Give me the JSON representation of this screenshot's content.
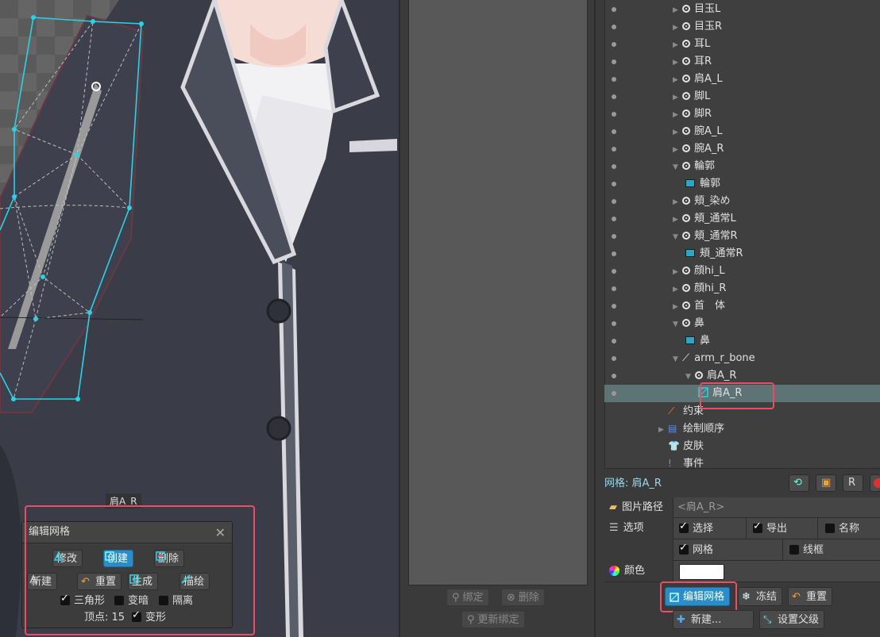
{
  "viewport": {
    "mesh_label": "肩A_R"
  },
  "edit_mesh_dialog": {
    "title": "编辑网格",
    "modes": {
      "modify": "修改",
      "create": "创建",
      "delete": "删除"
    },
    "actions": {
      "new": "新建",
      "reset": "重置",
      "generate": "生成",
      "trace": "描绘"
    },
    "options": {
      "triangles": "三角形",
      "dim": "变暗",
      "isolate": "隔离",
      "deform": "变形"
    },
    "vertices_label": "顶点:",
    "vertices_count": "15"
  },
  "binding_panel": {
    "bind": "绑定",
    "delete": "删除",
    "rebind": "更新绑定"
  },
  "tree": {
    "items": [
      {
        "label": "目玉L",
        "type": "bone"
      },
      {
        "label": "目玉R",
        "type": "bone"
      },
      {
        "label": "耳L",
        "type": "bone"
      },
      {
        "label": "耳R",
        "type": "bone"
      },
      {
        "label": "肩A_L",
        "type": "bone"
      },
      {
        "label": "脚L",
        "type": "bone"
      },
      {
        "label": "脚R",
        "type": "bone"
      },
      {
        "label": "腕A_L",
        "type": "bone"
      },
      {
        "label": "腕A_R",
        "type": "bone"
      },
      {
        "label": "輪郭",
        "type": "bone",
        "expanded": true
      },
      {
        "label": "輪郭",
        "type": "region"
      },
      {
        "label": "頬_染め",
        "type": "bone"
      },
      {
        "label": "頬_通常L",
        "type": "bone"
      },
      {
        "label": "頬_通常R",
        "type": "bone",
        "expanded": true
      },
      {
        "label": "頬_通常R",
        "type": "region"
      },
      {
        "label": "顔hi_L",
        "type": "bone"
      },
      {
        "label": "顔hi_R",
        "type": "bone"
      },
      {
        "label": "首　体",
        "type": "bone"
      },
      {
        "label": "鼻",
        "type": "bone",
        "expanded": true
      },
      {
        "label": "鼻",
        "type": "region"
      },
      {
        "label": "arm_r_bone",
        "type": "bone-pen",
        "expanded": true
      },
      {
        "label": "肩A_R",
        "type": "bone",
        "expanded": true
      },
      {
        "label": "肩A_R",
        "type": "mesh",
        "selected": true
      }
    ],
    "root_items": [
      {
        "label": "约束",
        "icon": "constraint-icon"
      },
      {
        "label": "绘制顺序",
        "icon": "draw-order-icon"
      },
      {
        "label": "皮肤",
        "icon": "skin-icon"
      },
      {
        "label": "事件",
        "icon": "event-icon"
      }
    ]
  },
  "properties": {
    "header": "网格: 肩A_R",
    "image_path_label": "图片路径",
    "image_path_value": "<肩A_R>",
    "options_label": "选项",
    "opt_select": "选择",
    "opt_export": "导出",
    "opt_name": "名称",
    "opt_mesh": "网格",
    "opt_wireframe": "线框",
    "color_label": "颜色",
    "color_value": "#ffffff"
  },
  "bottom_buttons": {
    "edit_mesh": "编辑网格",
    "freeze": "冻结",
    "reset": "重置",
    "new": "新建...",
    "set_parent": "设置父级"
  },
  "colors": {
    "accent": "#2a8cc8",
    "highlight": "#ef4c63",
    "mesh": "#27d3e8",
    "selection_row": "#5e7373"
  }
}
